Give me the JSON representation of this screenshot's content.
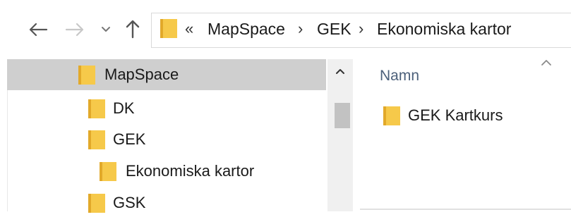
{
  "navigation": {
    "back_icon": "arrow-left-icon",
    "forward_icon": "arrow-right-icon",
    "recent_icon": "chevron-down-icon",
    "up_icon": "arrow-up-icon"
  },
  "address_bar": {
    "overflow_chevron": "«",
    "breadcrumbs": [
      "MapSpace",
      "GEK",
      "Ekonomiska kartor"
    ],
    "separator": "›"
  },
  "nav_tree": {
    "items": [
      {
        "label": "MapSpace",
        "selected": true
      },
      {
        "label": "DK",
        "selected": false
      },
      {
        "label": "GEK",
        "selected": false
      },
      {
        "label": "Ekonomiska kartor",
        "selected": false
      },
      {
        "label": "GSK",
        "selected": false
      }
    ]
  },
  "content": {
    "column_header": "Namn",
    "files": [
      {
        "name": "GEK Kartkurs",
        "type": "folder"
      }
    ]
  },
  "colors": {
    "folder_body": "#f6c94a",
    "folder_tab": "#e2a92a",
    "selection": "#cfcfcf",
    "header_text": "#4c607a"
  }
}
